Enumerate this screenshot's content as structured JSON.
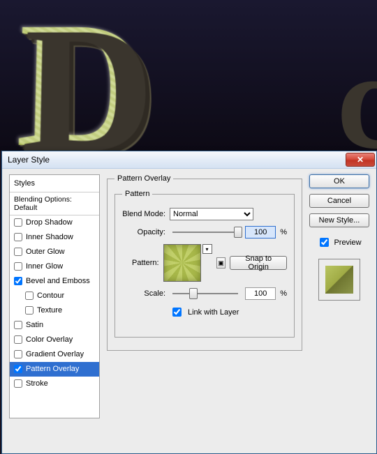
{
  "dialog": {
    "title": "Layer Style"
  },
  "styles_list": {
    "header": "Styles",
    "blending": "Blending Options: Default",
    "items": [
      {
        "label": "Drop Shadow",
        "checked": false,
        "indent": false
      },
      {
        "label": "Inner Shadow",
        "checked": false,
        "indent": false
      },
      {
        "label": "Outer Glow",
        "checked": false,
        "indent": false
      },
      {
        "label": "Inner Glow",
        "checked": false,
        "indent": false
      },
      {
        "label": "Bevel and Emboss",
        "checked": true,
        "indent": false
      },
      {
        "label": "Contour",
        "checked": false,
        "indent": true
      },
      {
        "label": "Texture",
        "checked": false,
        "indent": true
      },
      {
        "label": "Satin",
        "checked": false,
        "indent": false
      },
      {
        "label": "Color Overlay",
        "checked": false,
        "indent": false
      },
      {
        "label": "Gradient Overlay",
        "checked": false,
        "indent": false
      },
      {
        "label": "Pattern Overlay",
        "checked": true,
        "indent": false,
        "selected": true
      },
      {
        "label": "Stroke",
        "checked": false,
        "indent": false
      }
    ]
  },
  "settings": {
    "group_title": "Pattern Overlay",
    "inner_title": "Pattern",
    "blend_mode_label": "Blend Mode:",
    "blend_mode_value": "Normal",
    "opacity_label": "Opacity:",
    "opacity_value": "100",
    "percent": "%",
    "pattern_label": "Pattern:",
    "snap_label": "Snap to Origin",
    "scale_label": "Scale:",
    "scale_value": "100",
    "link_label": "Link with Layer",
    "link_checked": true
  },
  "buttons": {
    "ok": "OK",
    "cancel": "Cancel",
    "new_style": "New Style...",
    "preview": "Preview",
    "preview_checked": true
  }
}
